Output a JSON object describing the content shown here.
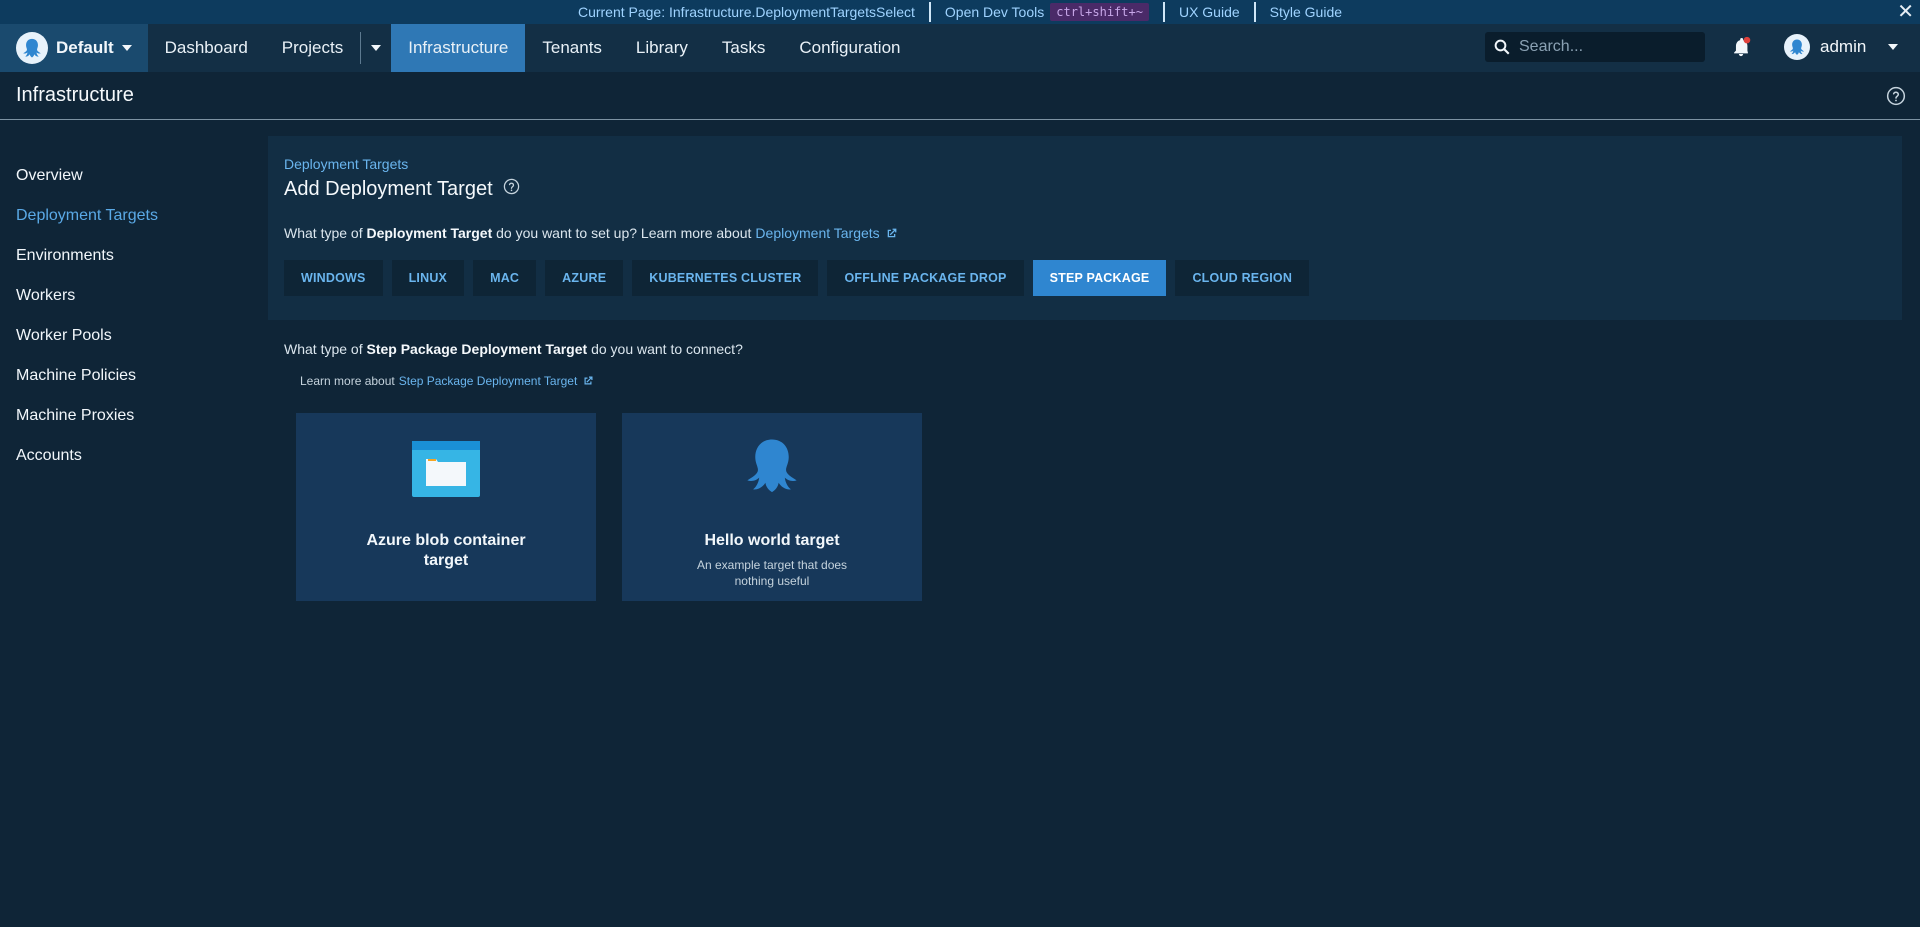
{
  "devbar": {
    "current_page": "Current Page: Infrastructure.DeploymentTargetsSelect",
    "dev_tools": "Open Dev Tools",
    "shortcut": "ctrl+shift+~",
    "ux_guide": "UX Guide",
    "style_guide": "Style Guide"
  },
  "nav": {
    "space": "Default",
    "items": [
      "Dashboard",
      "Projects",
      "Infrastructure",
      "Tenants",
      "Library",
      "Tasks",
      "Configuration"
    ],
    "search_placeholder": "Search...",
    "user": "admin"
  },
  "page": {
    "title": "Infrastructure"
  },
  "sidebar": {
    "items": [
      "Overview",
      "Deployment Targets",
      "Environments",
      "Workers",
      "Worker Pools",
      "Machine Policies",
      "Machine Proxies",
      "Accounts"
    ],
    "active": "Deployment Targets"
  },
  "panel": {
    "breadcrumb": "Deployment Targets",
    "title": "Add Deployment Target",
    "question_pre": "What type of",
    "question_bold": "Deployment Target",
    "question_post": "do you want to set up? Learn more about",
    "question_link": "Deployment Targets",
    "tabs": [
      "WINDOWS",
      "LINUX",
      "MAC",
      "AZURE",
      "KUBERNETES CLUSTER",
      "OFFLINE PACKAGE DROP",
      "STEP PACKAGE",
      "CLOUD REGION"
    ],
    "active_tab": "STEP PACKAGE"
  },
  "step_package": {
    "question_pre": "What type of",
    "question_bold": "Step Package Deployment Target",
    "question_post": "do you want to connect?",
    "learn_pre": "Learn more about",
    "learn_link": "Step Package Deployment Target",
    "cards": [
      {
        "title": "Azure blob container target",
        "description": "",
        "icon": "azure-blob-icon"
      },
      {
        "title": "Hello world target",
        "description": "An example target that does nothing useful",
        "icon": "octopus-icon"
      }
    ]
  },
  "colors": {
    "accent": "#2f86d0",
    "link": "#6ab5ee",
    "background": "#0f2537"
  }
}
